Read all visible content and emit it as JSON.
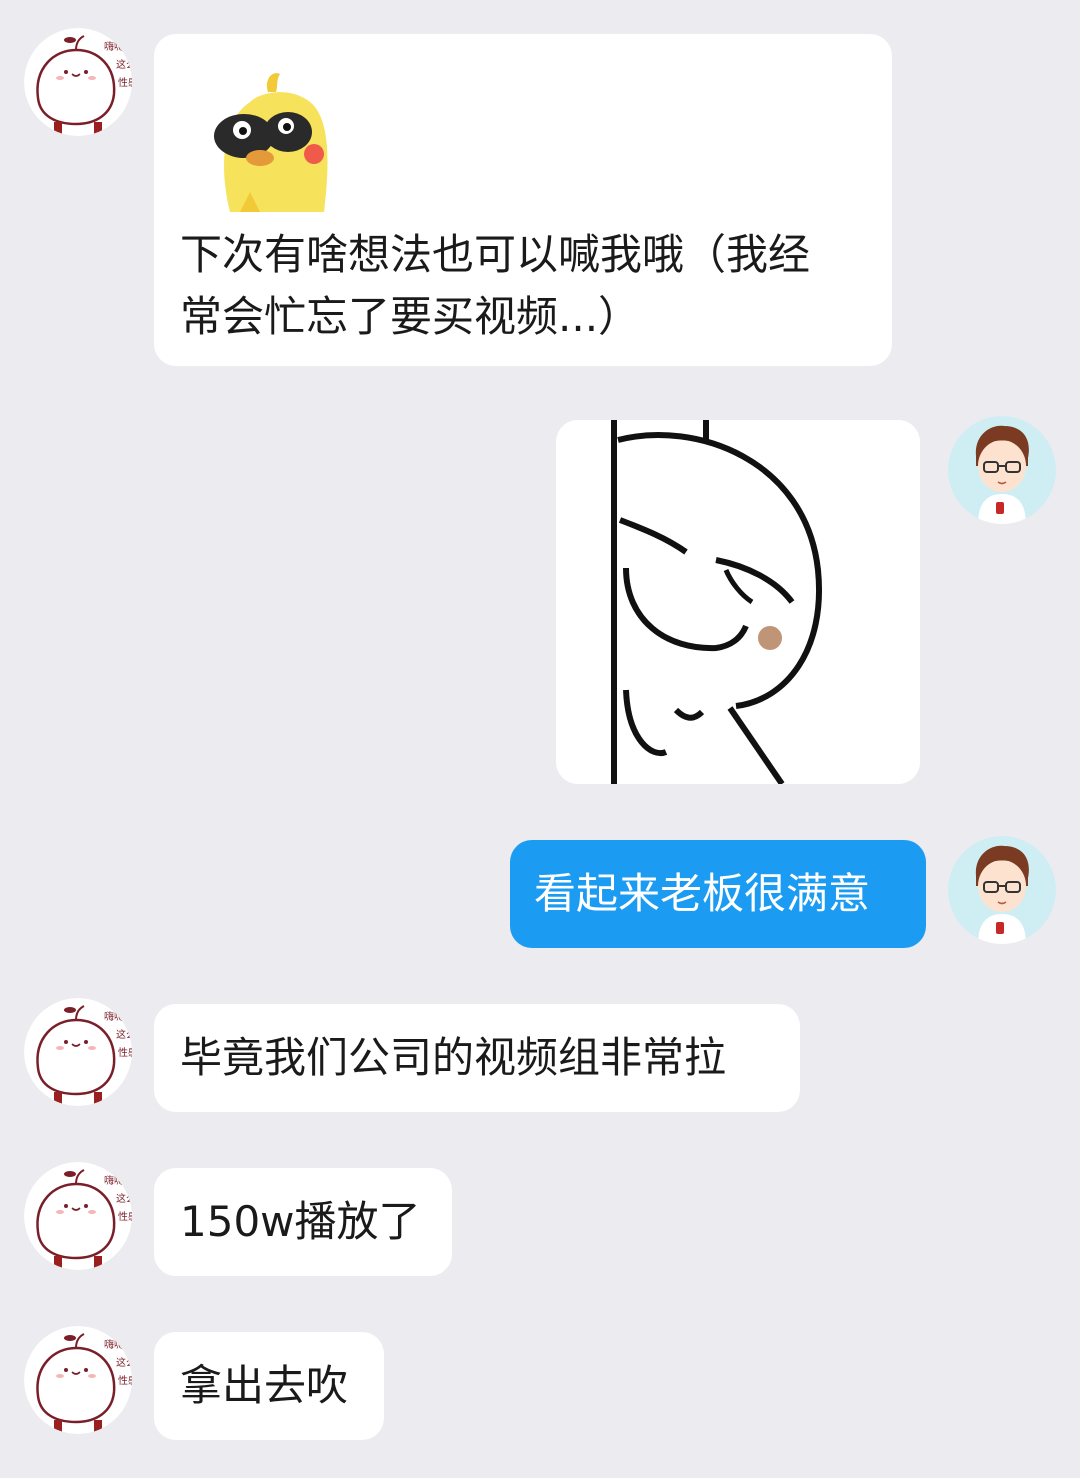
{
  "chat": {
    "messages": [
      {
        "sender": "other",
        "type": "sticker-with-text",
        "sticker": "yellow-duck-sticker",
        "lines": [
          "下次有啥想法也可以喊我哦（我经",
          "常会忙忘了要买视频...）"
        ]
      },
      {
        "sender": "me",
        "type": "sticker",
        "sticker": "peeking-face-sticker"
      },
      {
        "sender": "me",
        "type": "text",
        "text": "看起来老板很满意"
      },
      {
        "sender": "other",
        "type": "text",
        "text": "毕竟我们公司的视频组非常拉"
      },
      {
        "sender": "other",
        "type": "text",
        "text": "150w播放了"
      },
      {
        "sender": "other",
        "type": "text",
        "text": "拿出去吹"
      }
    ]
  },
  "avatars": {
    "other": {
      "icon": "cartoon-bun-avatar",
      "caption": "嗨嗨 这么性感"
    },
    "me": {
      "icon": "cartoon-boy-glasses-avatar"
    }
  },
  "colors": {
    "background": "#ebebf0",
    "bubble_other": "#ffffff",
    "bubble_me": "#1c9bf2",
    "text_other": "#1a1a1a",
    "text_me": "#ffffff"
  }
}
